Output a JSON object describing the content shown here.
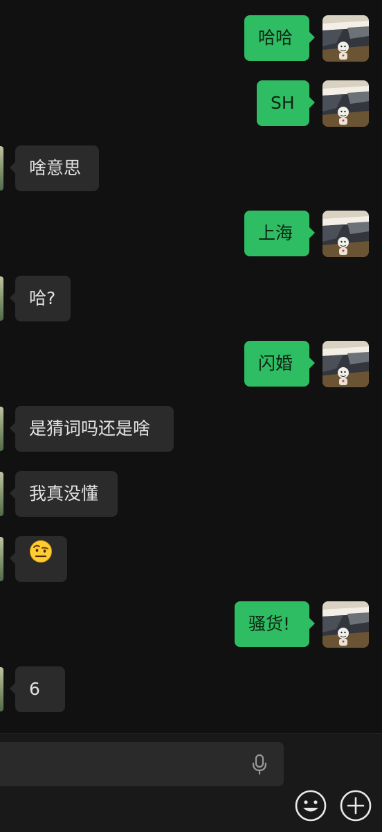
{
  "messages": [
    {
      "side": "me",
      "text": "哈哈"
    },
    {
      "side": "me",
      "text": "SH"
    },
    {
      "side": "them",
      "text": "啥意思"
    },
    {
      "side": "me",
      "text": "上海"
    },
    {
      "side": "them",
      "text": "哈?"
    },
    {
      "side": "me",
      "text": "闪婚"
    },
    {
      "side": "them",
      "text": "是猜词吗还是啥"
    },
    {
      "side": "them",
      "text": "我真没懂"
    },
    {
      "side": "them",
      "text": "",
      "emoji": "raised-eyebrow-emoji"
    },
    {
      "side": "me",
      "text": "骚货!"
    },
    {
      "side": "them",
      "text": "6"
    }
  ],
  "input_bar": {
    "text_value": "",
    "mic_icon": "microphone-icon",
    "emoji_icon": "smiley-face-icon",
    "plus_icon": "plus-circle-icon"
  },
  "colors": {
    "background": "#111111",
    "my_bubble": "#2fbd63",
    "their_bubble": "#2b2b2b",
    "input_bar": "#191919"
  }
}
